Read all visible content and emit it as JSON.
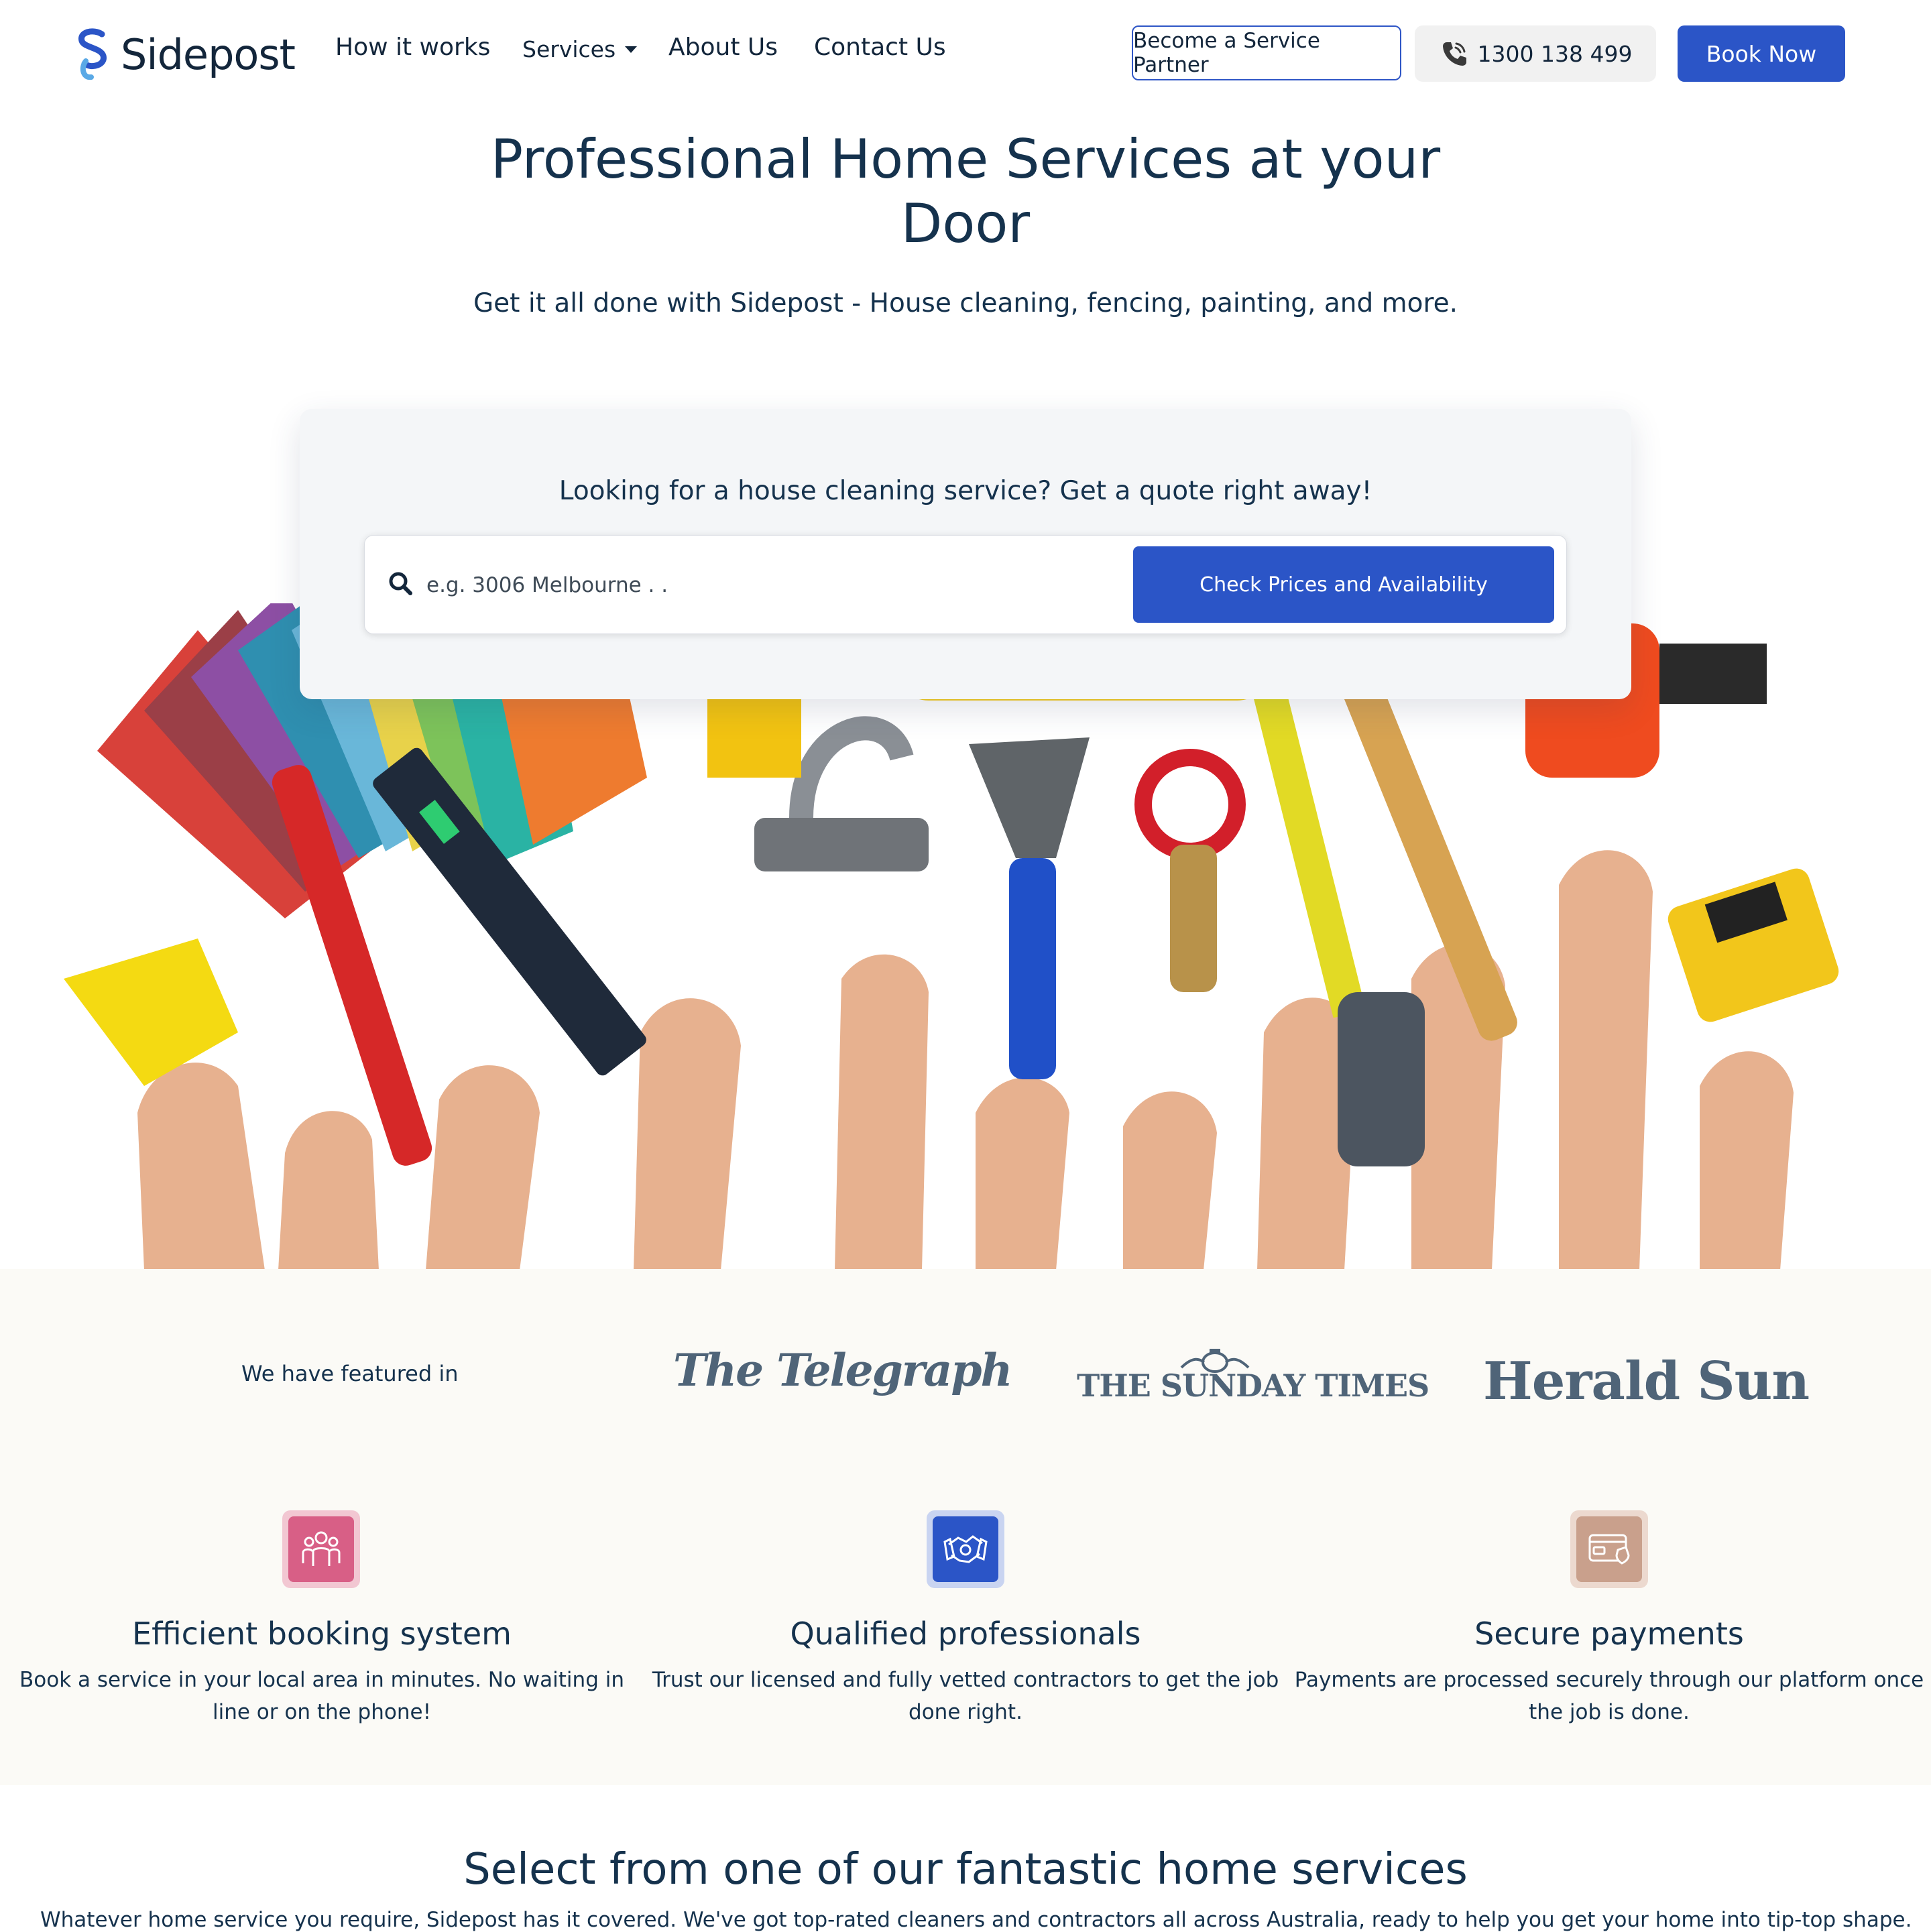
{
  "header": {
    "brand": "Sidepost",
    "nav": {
      "how_it_works": "How it works",
      "services": "Services",
      "about": "About Us",
      "contact": "Contact Us"
    },
    "partner_button": "Become a Service Partner",
    "phone": "1300 138 499",
    "book_button": "Book Now"
  },
  "hero": {
    "title": "Professional Home Services at your Door",
    "subtitle": "Get it all done with Sidepost - House cleaning, fencing, painting, and more."
  },
  "quote": {
    "title": "Looking for a house cleaning service? Get a quote right away!",
    "search_placeholder": "e.g. 3006 Melbourne . .",
    "search_value": "",
    "button": "Check Prices and Availability"
  },
  "featured": {
    "label": "We have featured in",
    "publications": [
      "The Telegraph",
      "THE SUNDAY TIMES",
      "Herald Sun"
    ]
  },
  "features": [
    {
      "icon": "team-icon",
      "title": "Efficient booking system",
      "description": "Book a service in your local area in minutes. No waiting in line or on the phone!",
      "color": "#d85f86"
    },
    {
      "icon": "handshake-icon",
      "title": "Qualified professionals",
      "description": "Trust our licensed and fully vetted contractors to get the job done right.",
      "color": "#2b55c7"
    },
    {
      "icon": "credit-card-icon",
      "title": "Secure payments",
      "description": "Payments are processed securely through our platform once the job is done.",
      "color": "#c9a08c"
    }
  ],
  "services_section": {
    "title": "Select from one of our fantastic home services",
    "description": "Whatever home service you require, Sidepost has it covered. We've got top-rated cleaners and contractors all across Australia, ready to help you get your home into tip-top shape."
  },
  "colors": {
    "primary": "#2b55c7",
    "heading": "#15324d",
    "band_bg": "#fbfaf6"
  }
}
